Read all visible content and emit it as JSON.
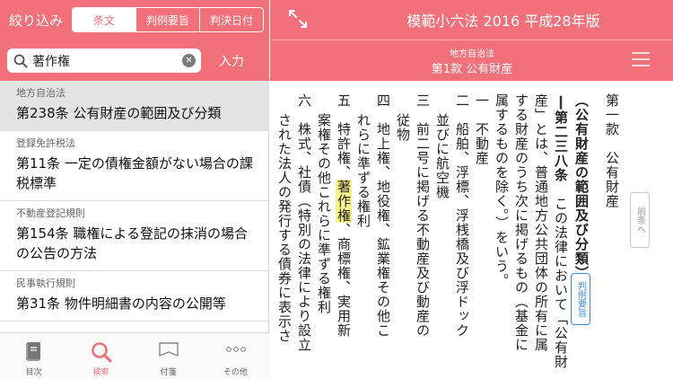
{
  "left": {
    "filter_label": "絞り込み",
    "segments": [
      "条文",
      "判例要旨",
      "判決日付"
    ],
    "active_segment": 0,
    "search": {
      "value": "著作権",
      "placeholder": ""
    },
    "enter_label": "入力",
    "results": [
      {
        "law": "地方自治法",
        "article": "第238条 公有財産の範囲及び分類"
      },
      {
        "law": "登録免許税法",
        "article": "第11条 一定の債権金額がない場合の課税標準"
      },
      {
        "law": "不動産登記規則",
        "article": "第154条 職権による登記の抹消の場合の公告の方法"
      },
      {
        "law": "民事執行規則",
        "article": "第31条 物件明細書の内容の公開等"
      }
    ],
    "tabs": [
      {
        "label": "目次",
        "icon": "book-icon"
      },
      {
        "label": "検索",
        "icon": "search-icon"
      },
      {
        "label": "付箋",
        "icon": "sticky-note-icon"
      },
      {
        "label": "その他",
        "icon": "more-icon"
      }
    ],
    "active_tab": 1
  },
  "right": {
    "book_title": "模範小六法 2016 平成28年版",
    "chapter_sub": "地方自治法",
    "chapter_title": "第1款 公有財産",
    "ruling_badge": "判例要旨",
    "prev_label": "前条へ",
    "text": {
      "section": "第一款　公有財産",
      "heading": "（公有財産の範囲及び分類）",
      "article_no": "第二三八条",
      "body_1a": "この法律において「公有財",
      "body_1b": "産」とは、普通地方公共団体の所有に属",
      "body_1c": "する財産のうち次に掲げるもの（基金に",
      "body_1d": "属するものを除く。）をいう。",
      "i1_no": "一",
      "i1": "不動産",
      "i2_no": "二",
      "i2a": "船舶、浮標、浮桟橋及び浮ドック",
      "i2b": "並びに航空機",
      "i3_no": "三",
      "i3a": "前二号に掲げる不動産及び動産の",
      "i3b": "従物",
      "i4_no": "四",
      "i4a": "地上権、地役権、鉱業権その他こ",
      "i4b": "れらに準ずる権利",
      "i5_no": "五",
      "i5_pre": "特許権、",
      "i5_hl": "著作権",
      "i5_post": "、商標権、実用新",
      "i5b": "案権その他これらに準ずる権利",
      "i6_no": "六",
      "i6a": "株式、社債（特別の法律により設立",
      "i6b": "された法人の発行する債券に表示さ"
    }
  },
  "colors": {
    "accent": "#f2707a",
    "highlight": "#fbf38a",
    "badge": "#3b8ad8"
  }
}
